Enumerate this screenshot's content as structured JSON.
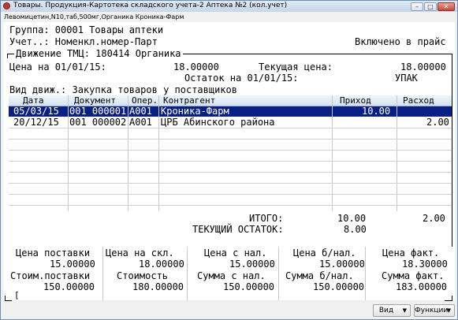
{
  "window": {
    "title": "Товары. Продукция-Картотека складского учета-2  Аптека №2 (кол.учет)",
    "subtitle": "Левомицетин,N10,таб,500мг,Органика Кроника-Фарм",
    "min_glyph": "–",
    "max_glyph": "□",
    "close_glyph": "✕"
  },
  "header": {
    "group": "Группа: 00001 Товары аптеки",
    "account": "Учет..: Номенкл.номер-Парт",
    "price_status": "Включено в прайс"
  },
  "movement": {
    "legend": "Движение ТМЦ: 180414 Органика",
    "price_on_date_label": "Цена на 01/01/15:",
    "price_on_date_value": "18.00000",
    "current_price_label": "Текущая цена:",
    "current_price_value": "18.00000",
    "balance_label": "Остаток на 01/01/15:",
    "balance_unit": "УПАК",
    "move_type": "Вид движ.: Закупка товаров у поставщиков"
  },
  "table": {
    "columns": [
      "Дата",
      "Документ",
      "Опер.",
      "Контрагент",
      "Приход",
      "Расход"
    ],
    "rows": [
      {
        "date": "05/03/15",
        "doc": "001 000001",
        "op": "А001",
        "party": "Кроника-Фарм",
        "income": "10.00",
        "expense": "",
        "selected": true
      },
      {
        "date": "20/12/15",
        "doc": "001 000002",
        "op": "А001",
        "party": "ЦРБ Абинского района",
        "income": "",
        "expense": "2.00",
        "selected": false
      }
    ]
  },
  "totals": {
    "total_label": "ИТОГО:",
    "total_income": "10.00",
    "total_expense": "2.00",
    "current_balance_label": "ТЕКУЩИЙ ОСТАТОК:",
    "current_balance_value": "8.00"
  },
  "summary": {
    "supply_price_label": "Цена поставки",
    "supply_price": "15.00000",
    "warehouse_price_label": "Цена на скл.",
    "warehouse_price": "18.00000",
    "price_vat_label": "Цена с нал.",
    "price_vat": "15.00000",
    "price_novat_label": "Цена б/нал.",
    "price_novat": "15.00000",
    "price_actual_label": "Цена факт.",
    "price_actual": "18.30000",
    "supply_cost_label": "Стоим.поставки",
    "supply_cost": "150.00000",
    "cost_label": "Стоимость",
    "cost": "180.00000",
    "sum_vat_label": "Сумма с нал.",
    "sum_vat": "150.00000",
    "sum_novat_label": "Сумма б/нал.",
    "sum_novat": "150.00000",
    "sum_actual_label": "Сумма факт.",
    "sum_actual": "183.00000"
  },
  "footer": {
    "bracket_left": "[",
    "view_button": "Вид",
    "functions_button": "Функции"
  }
}
